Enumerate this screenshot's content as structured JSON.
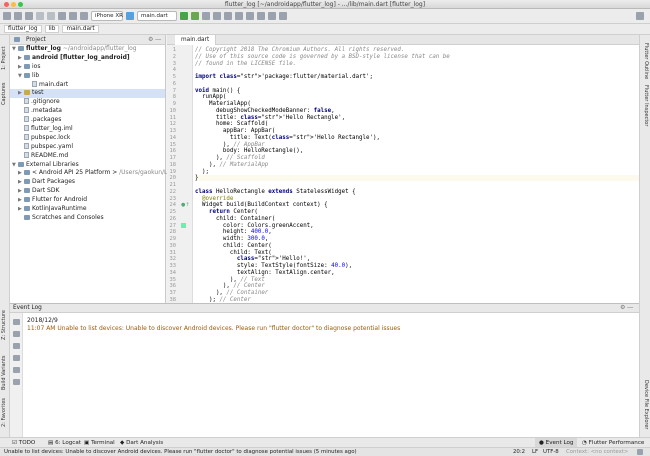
{
  "window_title": "flutter_log [~/androidapp/flutter_log] - .../lib/main.dart [flutter_log]",
  "toolbar": {
    "device": "iPhone XR",
    "run_config": "main.dart"
  },
  "breadcrumbs": [
    "flutter_log",
    "lib",
    "main.dart"
  ],
  "left_strip": [
    "1: Project",
    "Captures",
    "Z: Structure",
    "Build Variants",
    "2: Favorites"
  ],
  "right_strip": [
    "Flutter Outline",
    "Flutter Inspector",
    "Device File Explorer"
  ],
  "project": {
    "header": "Project",
    "items": [
      {
        "label": "flutter_log",
        "extra": "~/androidapp/flutter_log"
      },
      {
        "label": "android [flutter_log_android]"
      },
      {
        "label": "ios"
      },
      {
        "label": "lib"
      },
      {
        "label": "main.dart"
      },
      {
        "label": "test"
      },
      {
        "label": ".gitignore"
      },
      {
        "label": ".metadata"
      },
      {
        "label": ".packages"
      },
      {
        "label": "flutter_log.iml"
      },
      {
        "label": "pubspec.lock"
      },
      {
        "label": "pubspec.yaml"
      },
      {
        "label": "README.md"
      },
      {
        "label": "External Libraries"
      },
      {
        "label": "< Android API 25 Platform >",
        "extra": "/Users/gaokun/Lib"
      },
      {
        "label": "Dart Packages"
      },
      {
        "label": "Dart SDK"
      },
      {
        "label": "Flutter for Android"
      },
      {
        "label": "KotlinJavaRuntime"
      },
      {
        "label": "Scratches and Consoles"
      }
    ]
  },
  "editor": {
    "tab": "main.dart",
    "line_numbers": [
      "1",
      "2",
      "3",
      "4",
      "5",
      "6",
      "7",
      "8",
      "9",
      "10",
      "11",
      "12",
      "13",
      "14",
      "15",
      "16",
      "17",
      "18",
      "19",
      "20",
      "21",
      "22",
      "23",
      "24",
      "25",
      "26",
      "27",
      "28",
      "29",
      "30",
      "31",
      "32",
      "33",
      "34",
      "35",
      "36",
      "37",
      "38"
    ],
    "lines": [
      "// Copyright 2018 The Chromium Authors. All rights reserved.",
      "// Use of this source code is governed by a BSD-style license that can be",
      "// found in the LICENSE file.",
      "",
      "import 'package:flutter/material.dart';",
      "",
      "void main() {",
      "  runApp(",
      "    MaterialApp(",
      "      debugShowCheckedModeBanner: false,",
      "      title: 'Hello Rectangle',",
      "      home: Scaffold(",
      "        appBar: AppBar(",
      "          title: Text('Hello Rectangle'),",
      "        ), // AppBar",
      "        body: HelloRectangle(),",
      "      ), // Scaffold",
      "    ), // MaterialApp",
      "  );",
      "}",
      "",
      "class HelloRectangle extends StatelessWidget {",
      "  @override",
      "  Widget build(BuildContext context) {",
      "    return Center(",
      "      child: Container(",
      "        color: Colors.greenAccent,",
      "        height: 400.0,",
      "        width: 300.0,",
      "        child: Center(",
      "          child: Text(",
      "            'Hello!',",
      "            style: TextStyle(fontSize: 40.0),",
      "            textAlign: TextAlign.center,",
      "          ), // Text",
      "        ), // Center",
      "      ), // Container",
      "    ); // Center"
    ]
  },
  "event_log": {
    "title": "Event Log",
    "date": "2018/12/9",
    "time": "11:07 AM",
    "message": "Unable to list devices: Unable to discover Android devices. Please run \"flutter doctor\" to diagnose potential issues"
  },
  "bottom_tabs": [
    "TODO",
    "6: Logcat",
    "Terminal",
    "Dart Analysis",
    "Event Log",
    "Flutter Performance"
  ],
  "status": {
    "message": "Unable to list devices: Unable to discover Android devices. Please run \"flutter doctor\" to diagnose potential issues (5 minutes ago)",
    "position": "20:2",
    "line_sep": "LF",
    "encoding": "UTF-8",
    "context": "Context: <no context>"
  },
  "colors": {
    "accent": "#2e6fd6",
    "event_text": "#a05a00"
  }
}
